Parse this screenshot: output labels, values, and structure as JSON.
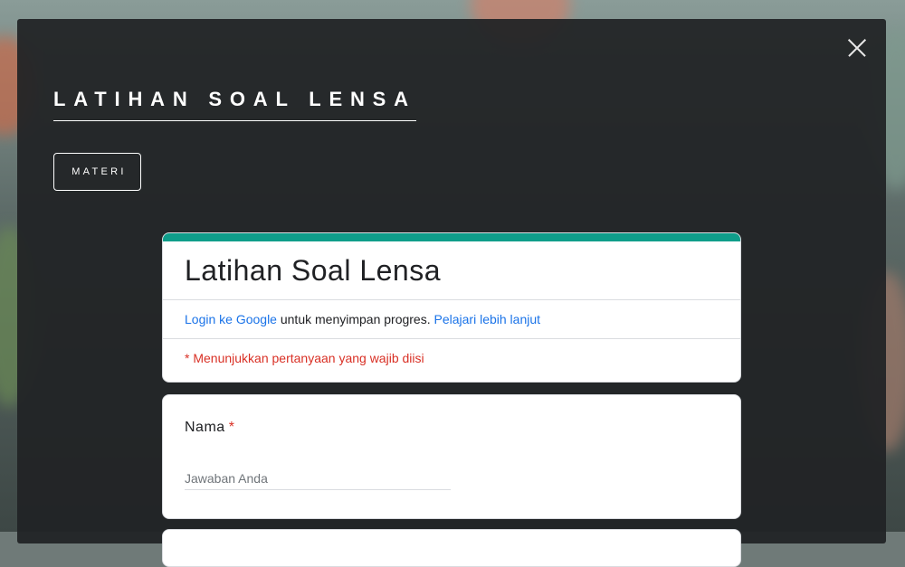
{
  "modal": {
    "title": "LATIHAN SOAL LENSA",
    "materi_button": "MATERI"
  },
  "form": {
    "title": "Latihan Soal Lensa",
    "login_link": "Login ke Google",
    "login_text": " untuk menyimpan progres. ",
    "learn_more_link": "Pelajari lebih lanjut",
    "required_note": "* Menunjukkan pertanyaan yang wajib diisi",
    "accent_color": "#0f9d8a"
  },
  "questions": [
    {
      "label": "Nama",
      "required_mark": "*",
      "placeholder": "Jawaban Anda",
      "value": ""
    }
  ],
  "icons": {
    "close": "close-icon"
  }
}
